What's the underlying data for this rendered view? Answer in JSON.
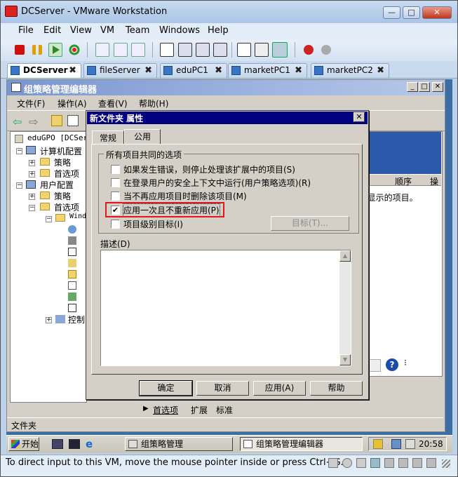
{
  "window": {
    "title": "DCServer - VMware Workstation",
    "min": "—",
    "max": "□",
    "close": "✕"
  },
  "menu": [
    "File",
    "Edit",
    "View",
    "VM",
    "Team",
    "Windows",
    "Help"
  ],
  "tabs": [
    {
      "label": "DCServer",
      "active": true
    },
    {
      "label": "fileServer"
    },
    {
      "label": "eduPC1"
    },
    {
      "label": "marketPC1"
    },
    {
      "label": "marketPC2"
    }
  ],
  "tab_close": "✖",
  "gpme": {
    "title": "组策略管理编辑器",
    "menu": [
      "文件(F)",
      "操作(A)",
      "查看(V)",
      "帮助(H)"
    ],
    "tree": {
      "root": "eduGPO [DCServ",
      "computer": "计算机配置",
      "policy1": "策略",
      "pref1": "首选项",
      "user": "用户配置",
      "policy2": "策略",
      "pref2": "首选项",
      "windows": "Wind",
      "control": "控制"
    },
    "right_cols": [
      "顺序",
      "操"
    ],
    "right_text": "]显示的项目。",
    "bottom_tabs": [
      "首选项",
      "扩展",
      "标准"
    ],
    "status": "文件夹"
  },
  "dialog": {
    "title": "新文件夹 属性",
    "close": "✕",
    "tabs": [
      "常规",
      "公用"
    ],
    "group_label": "所有项目共同的选项",
    "options": [
      {
        "label": "如果发生错误，则停止处理该扩展中的项目(S)",
        "checked": false
      },
      {
        "label": "在登录用户的安全上下文中运行(用户策略选项)(R)",
        "checked": false
      },
      {
        "label": "当不再应用项目时删除该项目(M)",
        "checked": false
      },
      {
        "label": "应用一次且不重新应用(P)",
        "checked": true
      },
      {
        "label": "项目级别目标(I)",
        "checked": false
      }
    ],
    "target_btn": "目标(T)...",
    "desc_label": "描述(D)",
    "buttons": [
      "确定",
      "取消",
      "应用(A)",
      "帮助"
    ]
  },
  "taskbar": {
    "start": "开始",
    "items": [
      "组策略管理",
      "组策略管理编辑器"
    ],
    "clock": "20:58"
  },
  "vm_status": "To direct input to this VM, move the mouse pointer inside or press Ctrl+G.",
  "colors": {
    "highlight": "#e8141c",
    "dialog_title": "#000080",
    "host_chrome": "#bcd1ea"
  }
}
